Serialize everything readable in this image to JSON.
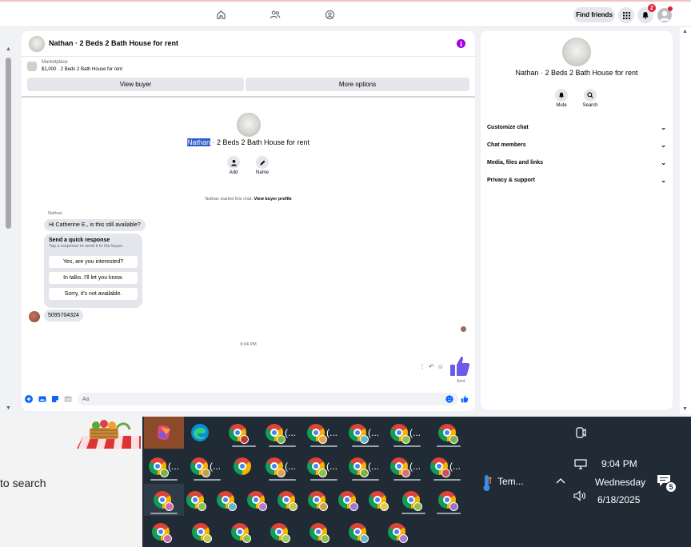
{
  "topbar": {
    "nav_icons": [
      "home-icon",
      "friends-icon",
      "groups-icon"
    ],
    "find_friends_label": "Find friends",
    "notification_count": "2"
  },
  "chat": {
    "header_title": "Nathan · 2 Beds 2 Bath House for rent",
    "listing": {
      "source": "Marketplace",
      "detail": "$1,000 · 2 Beds 2 Bath House for rent"
    },
    "view_buyer_label": "View buyer",
    "more_options_label": "More options",
    "center_title_name": "Nathan",
    "center_title_rest": " · 2 Beds 2 Bath House for rent",
    "add_label": "Add",
    "name_label": "Name",
    "started_note": "Nathan started this chat. ",
    "view_profile_link": "View buyer profile",
    "sender_name": "Nathan",
    "message": "Hi Catherine E., is this still available?",
    "quick_reply": {
      "title": "Send a quick response",
      "subtitle": "Tap a response to send it to the buyer.",
      "options": [
        "Yes, are you interested?",
        "In talks. I'll let you know.",
        "Sorry, it's not available."
      ]
    },
    "phone_message": "5095704324",
    "time_divider": "9:04 PM",
    "sent_label": "Sent",
    "composer_placeholder": "Aa",
    "accent_color": "#0866ff"
  },
  "info_panel": {
    "name": "Nathan · 2 Beds 2 Bath House for rent",
    "mute_label": "Mute",
    "search_label": "Search",
    "sections": [
      "Customize chat",
      "Chat members",
      "Media, files and links",
      "Privacy & support"
    ]
  },
  "taskbar": {
    "search_text": "to search",
    "ellipsis": "(...",
    "weather_label": "Tem...",
    "time": "9:04 PM",
    "day": "Wednesday",
    "date": "6/18/2025",
    "notification_count": "5"
  }
}
